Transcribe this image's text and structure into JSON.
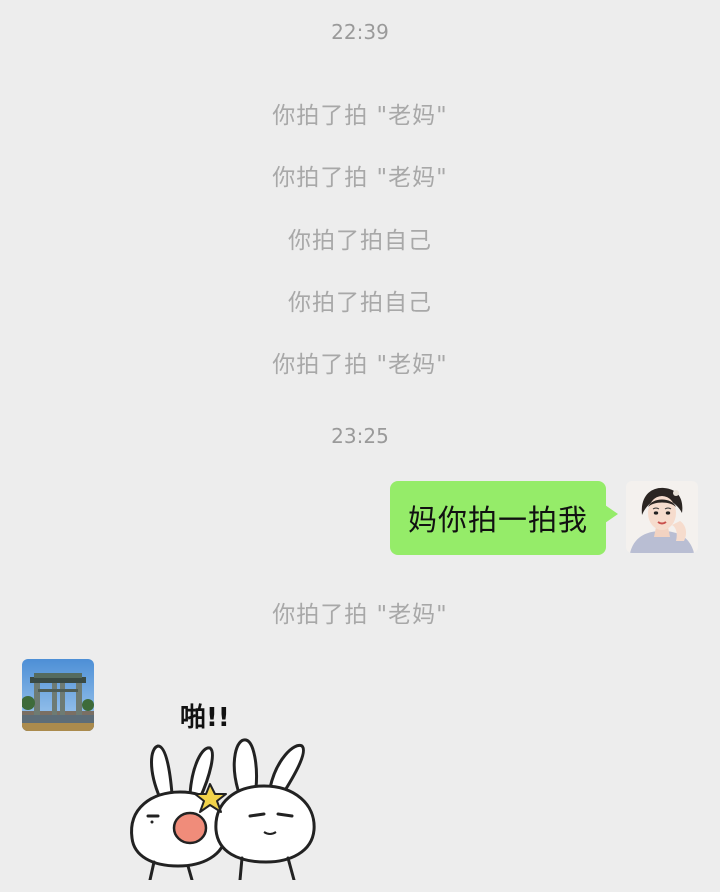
{
  "messages": {
    "time1": "22:39",
    "sys1": "你拍了拍 \"老妈\"",
    "sys2": "你拍了拍 \"老妈\"",
    "sys3": "你拍了拍自己",
    "sys4": "你拍了拍自己",
    "sys5": "你拍了拍 \"老妈\"",
    "time2": "23:25",
    "outgoing_text": "妈你拍一拍我",
    "sys6": "你拍了拍 \"老妈\"",
    "sticker_text": "啪!!"
  },
  "colors": {
    "background": "#ededed",
    "outgoing_bubble": "#95ec69",
    "system_text": "#a8a8a8"
  },
  "icons": {
    "self_avatar": "woman-portrait-avatar",
    "contact_avatar": "landscape-gate-avatar",
    "sticker": "rabbit-slap-sticker"
  }
}
